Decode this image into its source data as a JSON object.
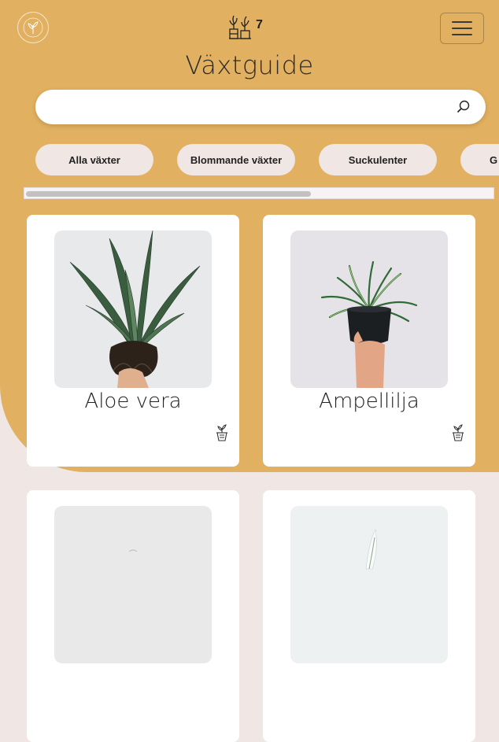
{
  "header": {
    "logo_icon": "plant-logo-icon",
    "counter_icon": "plant-shelf-icon",
    "counter_value": "7",
    "menu_icon": "hamburger-icon"
  },
  "page": {
    "title": "Växtguide"
  },
  "search": {
    "value": "",
    "placeholder": "",
    "icon": "search-icon"
  },
  "categories": [
    {
      "label": "Alla växter"
    },
    {
      "label": "Blommande växter"
    },
    {
      "label": "Suckulenter"
    },
    {
      "label": "G"
    }
  ],
  "plants": [
    {
      "name": "Aloe vera",
      "add_icon": "potted-plant-add-icon"
    },
    {
      "name": "Ampellilja",
      "add_icon": "potted-plant-add-icon"
    },
    {
      "name": "",
      "add_icon": ""
    },
    {
      "name": "",
      "add_icon": ""
    }
  ],
  "colors": {
    "background": "#e1b060",
    "accent_light": "#f0e6e4",
    "card": "#ffffff"
  }
}
